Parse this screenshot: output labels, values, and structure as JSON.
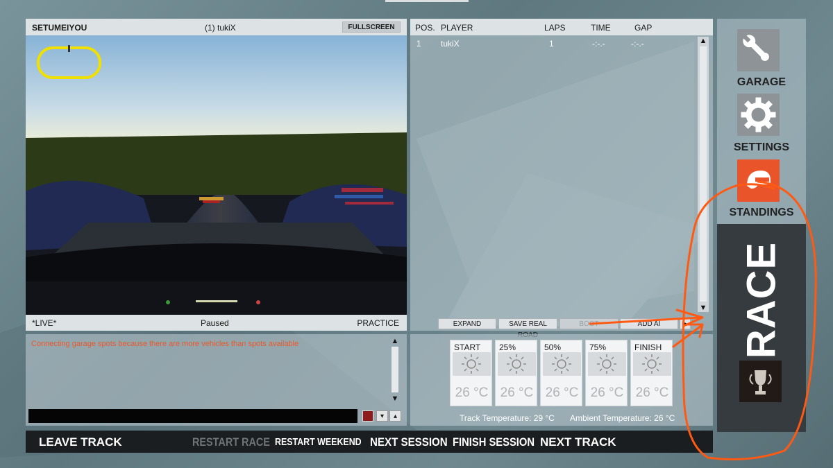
{
  "viewport": {
    "driver_name": "SETUMEIYOU",
    "player_label": "(1) tukiX",
    "fullscreen_label": "FULLSCREEN",
    "live_label": "*LIVE*",
    "status": "Paused",
    "session": "PRACTICE"
  },
  "standings": {
    "columns": {
      "pos": "POS.",
      "player": "PLAYER",
      "laps": "LAPS",
      "time": "TIME",
      "gap": "GAP"
    },
    "rows": [
      {
        "pos": "1",
        "player": "tukiX",
        "laps": "1",
        "time": "-:-.-",
        "gap": "-:-.-"
      }
    ],
    "buttons": {
      "expand": "EXPAND",
      "save_real_road": "SAVE REAL ROAD",
      "boot": "BOOT",
      "add_ai": "ADD AI",
      "more": "▶"
    }
  },
  "chat": {
    "message": "Connecting garage spots because there are more vehicles than spots available",
    "color_swatch": "#8e1c1c"
  },
  "weather": {
    "cards": [
      {
        "label": "START",
        "temp": "26 °C"
      },
      {
        "label": "25%",
        "temp": "26 °C"
      },
      {
        "label": "50%",
        "temp": "26 °C"
      },
      {
        "label": "75%",
        "temp": "26 °C"
      },
      {
        "label": "FINISH",
        "temp": "26 °C"
      }
    ],
    "track_temp": "Track Temperature:  29 °C",
    "ambient_temp": "Ambient Temperature:  26 °C"
  },
  "bottom_bar": {
    "leave_track": "LEAVE TRACK",
    "restart_race": "RESTART RACE",
    "restart_weekend": "RESTART WEEKEND",
    "next_session": "NEXT SESSION",
    "finish_session": "FINISH SESSION",
    "next_track": "NEXT TRACK"
  },
  "menu": {
    "garage": "GARAGE",
    "settings": "SETTINGS",
    "standings": "STANDINGS",
    "race": "RACE",
    "icons": {
      "garage": "wrench-icon",
      "settings": "gear-icon",
      "standings": "helmet-icon",
      "race": "trophy-icon"
    },
    "colors": {
      "standings_tile": "#e9542a",
      "tile_gray": "#8d9396"
    }
  },
  "annotation_color": "#ff5a14"
}
